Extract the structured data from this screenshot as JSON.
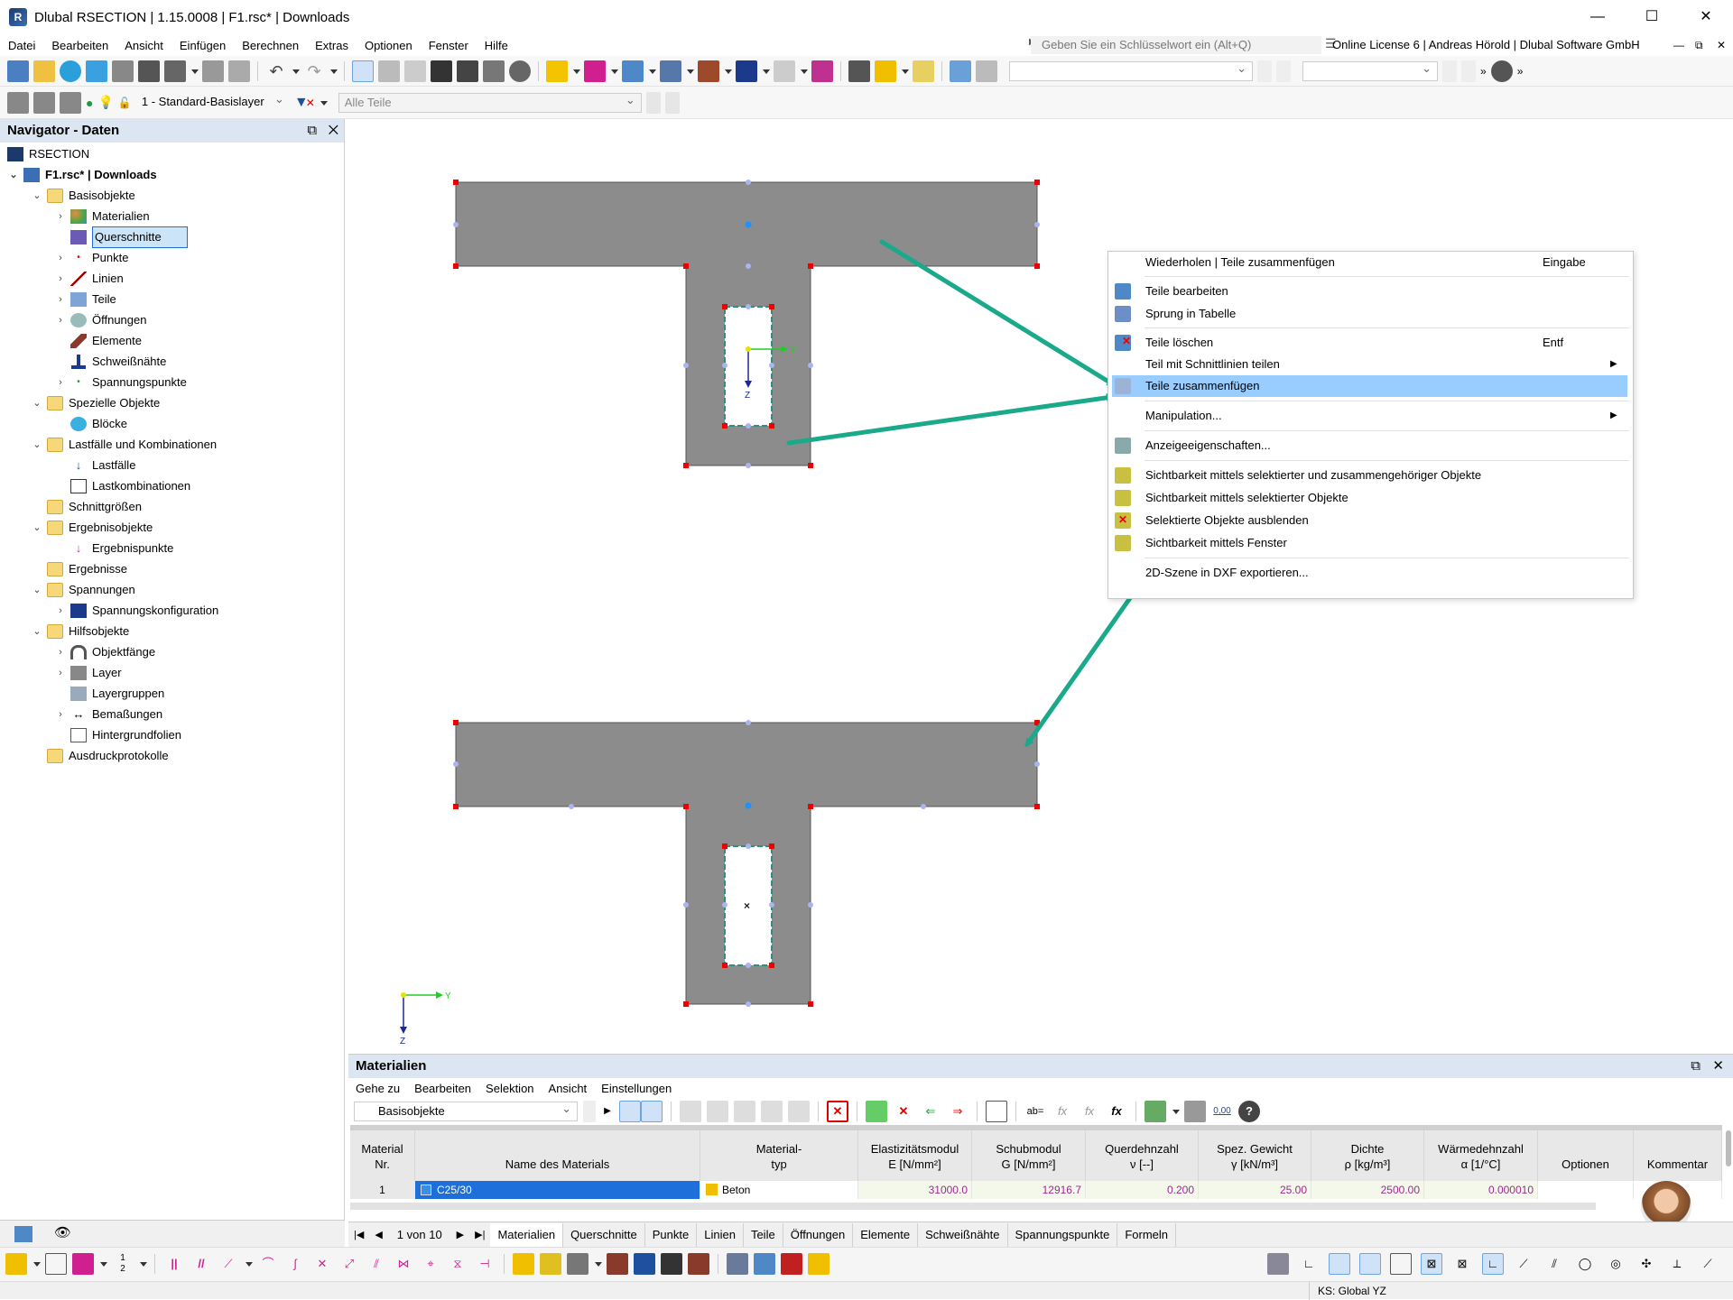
{
  "window": {
    "title": "Dlubal RSECTION | 1.15.0008 | F1.rsc* | Downloads",
    "minimize": "—",
    "maximize": "☐",
    "close": "✕"
  },
  "menu": {
    "items": [
      "Datei",
      "Bearbeiten",
      "Ansicht",
      "Einfügen",
      "Berechnen",
      "Extras",
      "Optionen",
      "Fenster",
      "Hilfe"
    ],
    "search_placeholder": "Geben Sie ein Schlüsselwort ein (Alt+Q)",
    "license": "Online License 6 | Andreas Hörold | Dlubal Software GmbH"
  },
  "toolbar2": {
    "layer": "1 - Standard-Basislayer",
    "parts_filter": "Alle Teile"
  },
  "navigator": {
    "title": "Navigator - Daten",
    "items": [
      {
        "label": "RSECTION"
      },
      {
        "label": "F1.rsc* | Downloads"
      },
      {
        "label": "Basisobjekte"
      },
      {
        "label": "Materialien"
      },
      {
        "label": "Querschnitte"
      },
      {
        "label": "Punkte"
      },
      {
        "label": "Linien"
      },
      {
        "label": "Teile"
      },
      {
        "label": "Öffnungen"
      },
      {
        "label": "Elemente"
      },
      {
        "label": "Schweißnähte"
      },
      {
        "label": "Spannungspunkte"
      },
      {
        "label": "Spezielle Objekte"
      },
      {
        "label": "Blöcke"
      },
      {
        "label": "Lastfälle und Kombinationen"
      },
      {
        "label": "Lastfälle"
      },
      {
        "label": "Lastkombinationen"
      },
      {
        "label": "Schnittgrößen"
      },
      {
        "label": "Ergebnisobjekte"
      },
      {
        "label": "Ergebnispunkte"
      },
      {
        "label": "Ergebnisse"
      },
      {
        "label": "Spannungen"
      },
      {
        "label": "Spannungskonfiguration"
      },
      {
        "label": "Hilfsobjekte"
      },
      {
        "label": "Objektfänge"
      },
      {
        "label": "Layer"
      },
      {
        "label": "Layergruppen"
      },
      {
        "label": "Bemaßungen"
      },
      {
        "label": "Hintergrundfolien"
      },
      {
        "label": "Ausdruckprotokolle"
      }
    ]
  },
  "canvas": {
    "axis_y": "Y",
    "axis_z": "Z"
  },
  "context_menu": {
    "items": [
      {
        "label": "Wiederholen | Teile zusammenfügen",
        "shortcut": "Eingabe"
      },
      {
        "label": "Teile bearbeiten"
      },
      {
        "label": "Sprung in Tabelle"
      },
      {
        "label": "Teile löschen",
        "shortcut": "Entf"
      },
      {
        "label": "Teil mit Schnittlinien teilen"
      },
      {
        "label": "Teile zusammenfügen"
      },
      {
        "label": "Manipulation..."
      },
      {
        "label": "Anzeigeeigenschaften..."
      },
      {
        "label": "Sichtbarkeit mittels selektierter und zusammengehöriger Objekte"
      },
      {
        "label": "Sichtbarkeit mittels selektierter Objekte"
      },
      {
        "label": "Selektierte Objekte ausblenden"
      },
      {
        "label": "Sichtbarkeit mittels Fenster"
      },
      {
        "label": "2D-Szene in DXF exportieren..."
      }
    ]
  },
  "materials": {
    "title": "Materialien",
    "menu": [
      "Gehe zu",
      "Bearbeiten",
      "Selektion",
      "Ansicht",
      "Einstellungen"
    ],
    "filter": "Basisobjekte",
    "headers": [
      {
        "l1": "Material",
        "l2": "Nr."
      },
      {
        "l1": "",
        "l2": "Name des Materials"
      },
      {
        "l1": "Material-",
        "l2": "typ"
      },
      {
        "l1": "Elastizitätsmodul",
        "l2": "E [N/mm²]"
      },
      {
        "l1": "Schubmodul",
        "l2": "G [N/mm²]"
      },
      {
        "l1": "Querdehnzahl",
        "l2": "ν [--]"
      },
      {
        "l1": "Spez. Gewicht",
        "l2": "γ [kN/m³]"
      },
      {
        "l1": "Dichte",
        "l2": "ρ [kg/m³]"
      },
      {
        "l1": "Wärmedehnzahl",
        "l2": "α [1/°C]"
      },
      {
        "l1": "",
        "l2": "Optionen"
      },
      {
        "l1": "",
        "l2": "Kommentar"
      }
    ],
    "row": {
      "nr": "1",
      "name": "C25/30",
      "type": "Beton",
      "e": "31000.0",
      "g": "12916.7",
      "nu": "0.200",
      "gamma": "25.00",
      "rho": "2500.00",
      "alpha": "0.000010"
    },
    "pager": "1 von 10",
    "tabs": [
      "Materialien",
      "Querschnitte",
      "Punkte",
      "Linien",
      "Teile",
      "Öffnungen",
      "Elemente",
      "Schweißnähte",
      "Spannungspunkte",
      "Formeln"
    ]
  },
  "status": {
    "cs": "KS: Global YZ"
  },
  "colors": {
    "accent": "#1ba98b",
    "selection": "#99ccff",
    "panel_header": "#dce6f2"
  }
}
